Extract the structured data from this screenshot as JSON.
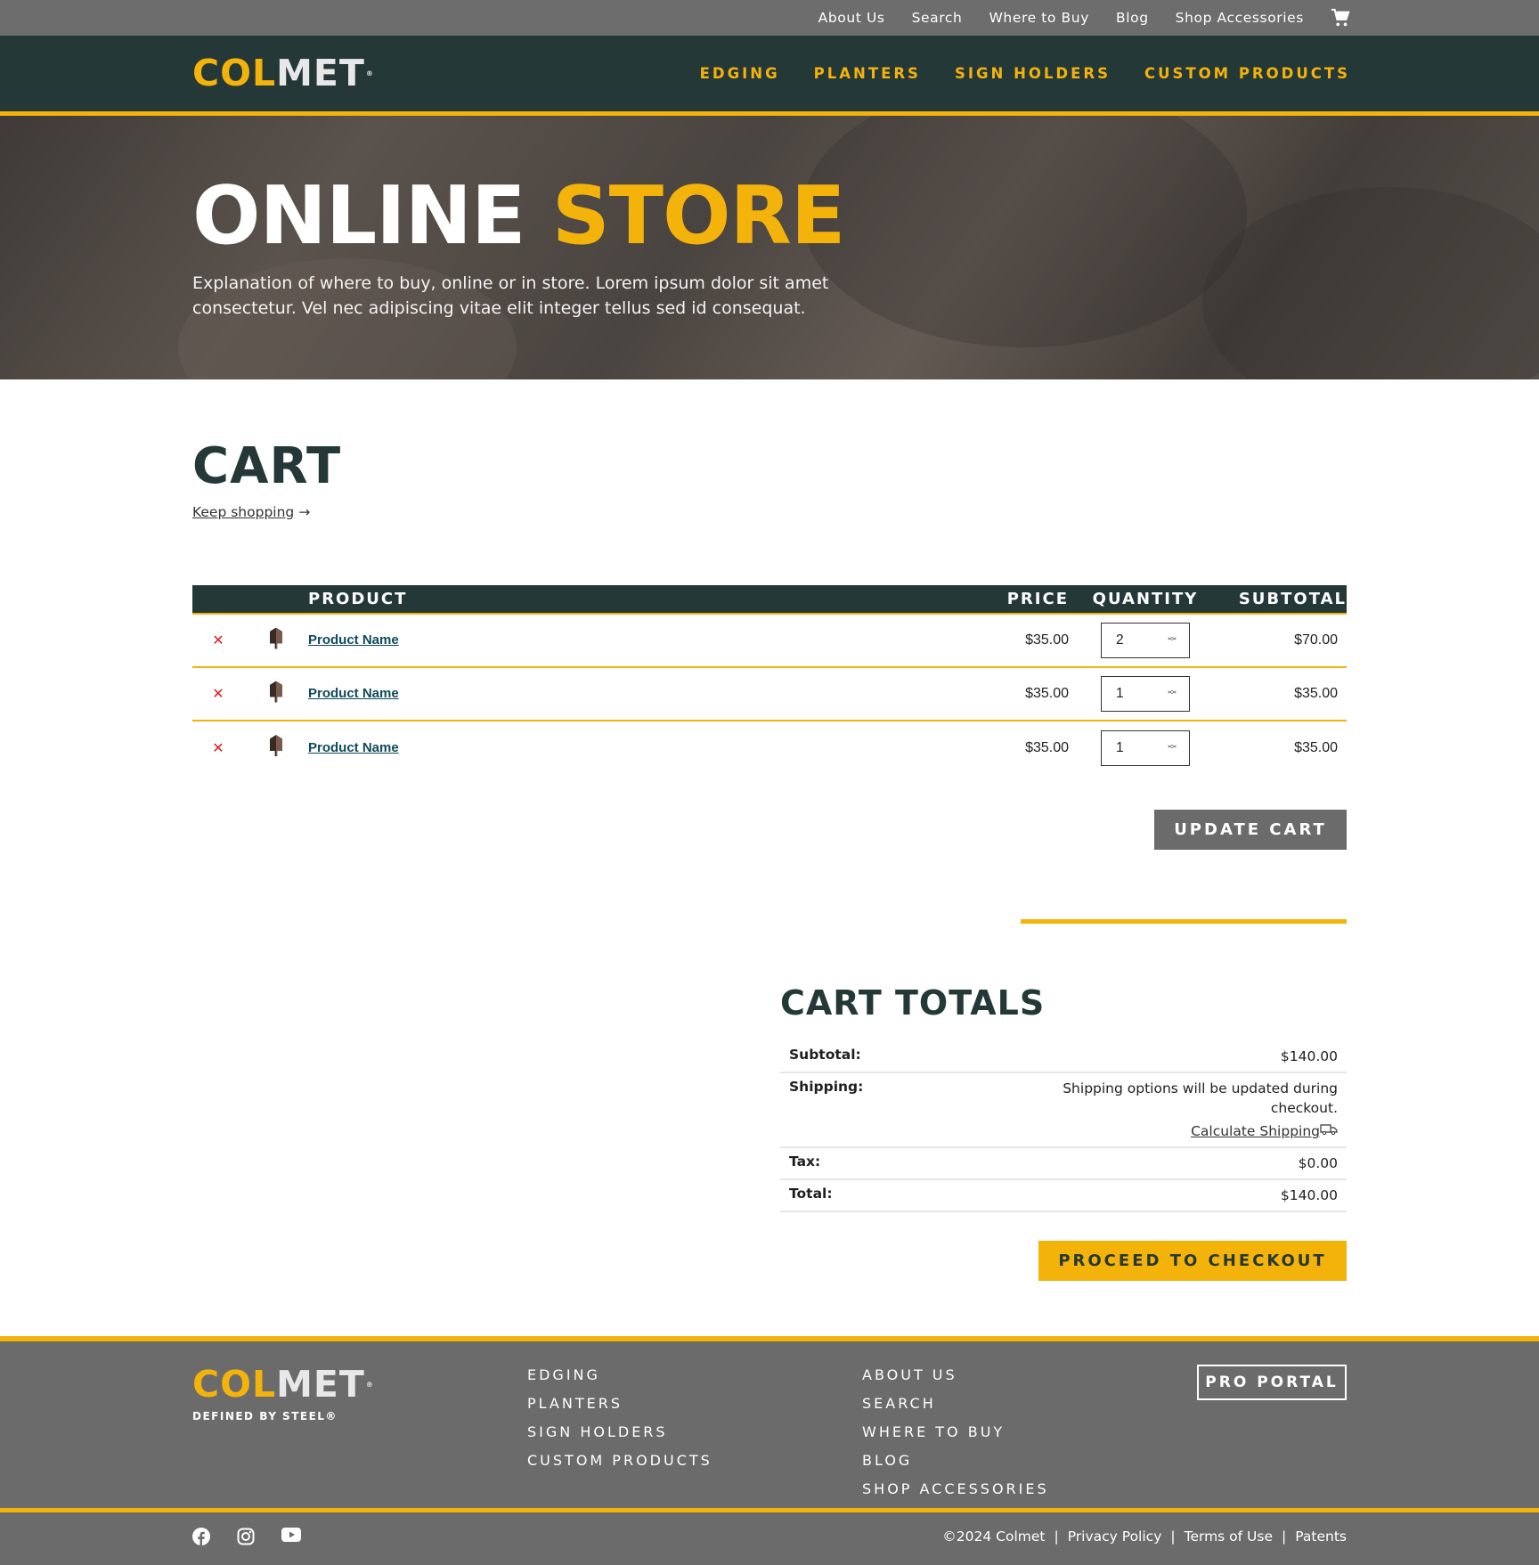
{
  "topbar": {
    "links": [
      "About Us",
      "Search",
      "Where to Buy",
      "Blog",
      "Shop Accessories"
    ],
    "cart_icon": "shopping-cart-icon"
  },
  "brand": {
    "logo_part1": "COL",
    "logo_part2": "MET",
    "reg": "®",
    "tagline": "DEFINED BY STEEL®"
  },
  "mainnav": {
    "items": [
      "EDGING",
      "PLANTERS",
      "SIGN HOLDERS",
      "CUSTOM PRODUCTS"
    ]
  },
  "hero": {
    "title_white": "ONLINE",
    "title_yellow": "STORE",
    "description": "Explanation of where to buy, online or in store. Lorem ipsum dolor sit amet consectetur. Vel nec adipiscing vitae elit integer tellus sed id consequat."
  },
  "cart": {
    "title": "CART",
    "keep_shopping": "Keep shopping",
    "columns": {
      "product": "PRODUCT",
      "price": "PRICE",
      "quantity": "QUANTITY",
      "subtotal": "SUBTOTAL"
    },
    "rows": [
      {
        "name": "Product Name",
        "price": "$35.00",
        "qty": "2",
        "subtotal": "$70.00"
      },
      {
        "name": "Product Name",
        "price": "$35.00",
        "qty": "1",
        "subtotal": "$35.00"
      },
      {
        "name": "Product Name",
        "price": "$35.00",
        "qty": "1",
        "subtotal": "$35.00"
      }
    ],
    "update_button": "UPDATE CART"
  },
  "totals": {
    "title": "CART TOTALS",
    "subtotal_label": "Subtotal:",
    "subtotal_value": "$140.00",
    "shipping_label": "Shipping:",
    "shipping_note": "Shipping options will be updated during checkout.",
    "calculate_shipping": "Calculate Shipping",
    "tax_label": "Tax:",
    "tax_value": "$0.00",
    "total_label": "Total:",
    "total_value": "$140.00",
    "checkout_button": "PROCEED TO CHECKOUT"
  },
  "footer": {
    "col1": [
      "EDGING",
      "PLANTERS",
      "SIGN HOLDERS",
      "CUSTOM PRODUCTS"
    ],
    "col2": [
      "ABOUT US",
      "SEARCH",
      "WHERE TO BUY",
      "BLOG",
      "SHOP ACCESSORIES"
    ],
    "pro_portal": "PRO PORTAL",
    "social": [
      "facebook-icon",
      "instagram-icon",
      "youtube-icon"
    ],
    "copyright": "©2024 Colmet",
    "legal_links": [
      "Privacy Policy",
      "Terms of Use",
      "Patents"
    ]
  },
  "colors": {
    "accent": "#f4b30b",
    "dark": "#253838",
    "gray": "#6b6b6b",
    "remove": "#e01b1b"
  }
}
